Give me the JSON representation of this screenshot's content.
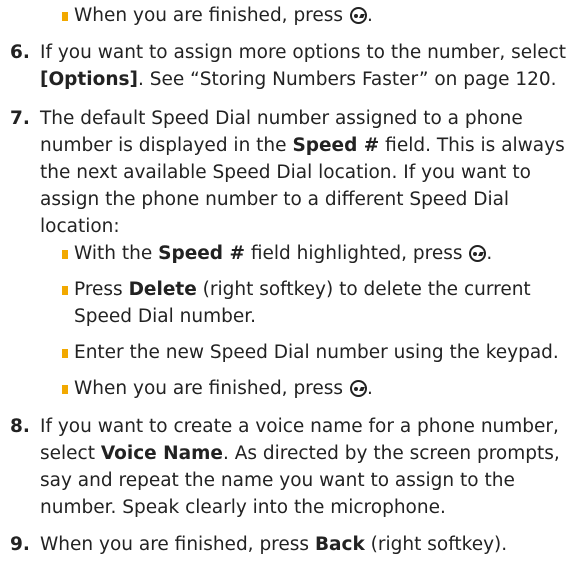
{
  "bullets_top": {
    "b0": {
      "before": "When you are finished, press ",
      "icon": "ok-key-icon",
      "after": "."
    }
  },
  "steps": {
    "s6": {
      "num": "6.",
      "l1": "If you want to assign more options to the number, select",
      "l2_bold": "[Options]",
      "l2_rest": ". See “Storing Numbers Faster” on page 120."
    },
    "s7": {
      "num": "7.",
      "l1": "The default Speed Dial number assigned to a phone",
      "l2_a": "number is displayed in the ",
      "l2_bold": "Speed #",
      "l2_b": " field. This is always",
      "l3": "the next available Speed Dial location. If you want to",
      "l4": "assign the phone number to a different Speed Dial",
      "l5": "location:",
      "bullets": {
        "b1": {
          "before": "With the ",
          "bold": "Speed #",
          "after": " field highlighted, press ",
          "icon": "ok-key-icon",
          "end": "."
        },
        "b2": {
          "before": "Press ",
          "bold": "Delete",
          "after": " (right softkey) to delete the current",
          "cont": "Speed Dial number."
        },
        "b3": {
          "text": "Enter the new Speed Dial number using the keypad."
        },
        "b4": {
          "before": "When you are finished, press ",
          "icon": "ok-key-icon",
          "end": "."
        }
      }
    },
    "s8": {
      "num": "8.",
      "l1": "If you want to create a voice name for a phone number,",
      "l2_a": "select ",
      "l2_bold": "Voice Name",
      "l2_b": ". As directed by the screen prompts,",
      "l3": "say and repeat the name you want to assign to the",
      "l4": "number. Speak clearly into the microphone."
    },
    "s9": {
      "num": "9.",
      "l1_a": "When you are finished, press ",
      "l1_bold": "Back",
      "l1_b": " (right softkey)."
    }
  },
  "colors": {
    "bullet": "#f2a900",
    "text": "#222222"
  }
}
